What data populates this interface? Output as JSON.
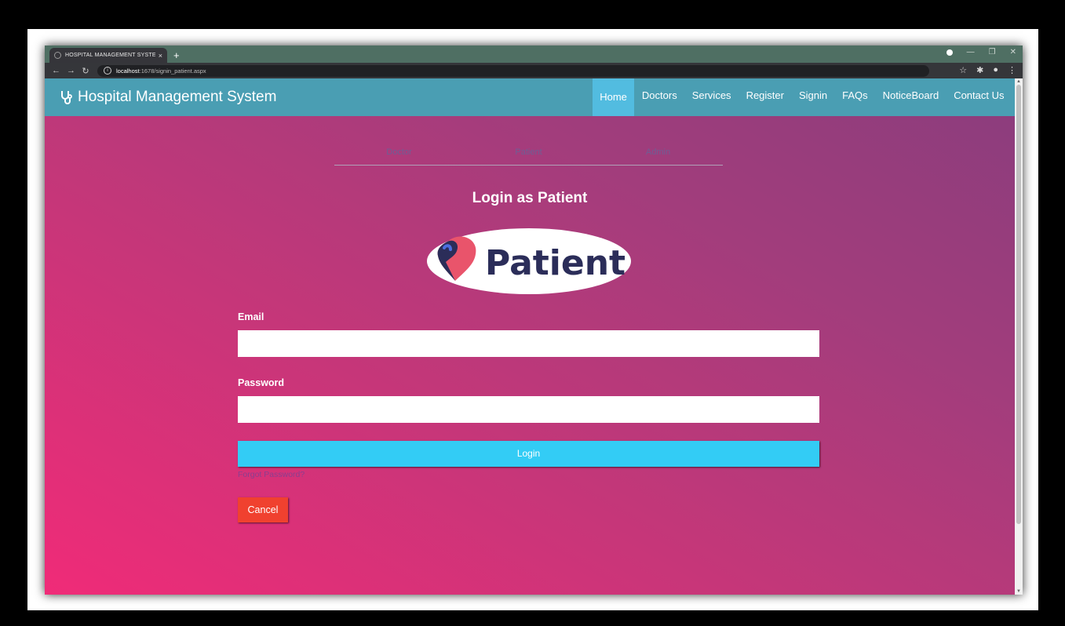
{
  "browser": {
    "tab_title": "HOSPITAL MANAGEMENT SYSTE",
    "tab_close": "×",
    "new_tab": "+",
    "url_host": "localhost",
    "url_path": ":1678/signin_patient.aspx"
  },
  "navbar": {
    "brand": "Hospital Management System",
    "links": [
      "Home",
      "Doctors",
      "Services",
      "Register",
      "Signin",
      "FAQs",
      "NoticeBoard",
      "Contact Us"
    ]
  },
  "role_tabs": [
    "Doctor",
    "Patient",
    "Admin"
  ],
  "login": {
    "title": "Login as Patient",
    "logo_text": "Patient",
    "email_label": "Email",
    "email_value": "",
    "password_label": "Password",
    "password_value": "",
    "login_button": "Login",
    "forgot_password": "Forgot Password?",
    "cancel_button": "Cancel"
  },
  "colors": {
    "navbar": "#4a9eb3",
    "nav_active": "#52bce0",
    "login_button": "#33ccf5",
    "cancel_button": "#f0412f",
    "logo_navy": "#2b2d59"
  }
}
